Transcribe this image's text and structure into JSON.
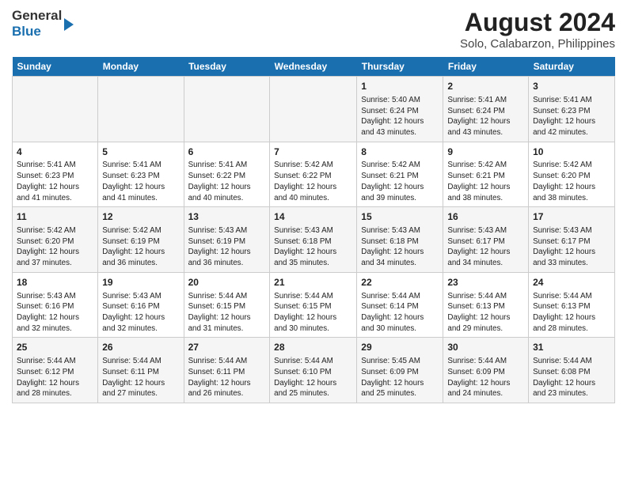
{
  "header": {
    "logo": {
      "line1": "General",
      "line2": "Blue"
    },
    "title": "August 2024",
    "subtitle": "Solo, Calabarzon, Philippines"
  },
  "days_of_week": [
    "Sunday",
    "Monday",
    "Tuesday",
    "Wednesday",
    "Thursday",
    "Friday",
    "Saturday"
  ],
  "weeks": [
    [
      {
        "day": "",
        "info": ""
      },
      {
        "day": "",
        "info": ""
      },
      {
        "day": "",
        "info": ""
      },
      {
        "day": "",
        "info": ""
      },
      {
        "day": "1",
        "info": "Sunrise: 5:40 AM\nSunset: 6:24 PM\nDaylight: 12 hours\nand 43 minutes."
      },
      {
        "day": "2",
        "info": "Sunrise: 5:41 AM\nSunset: 6:24 PM\nDaylight: 12 hours\nand 43 minutes."
      },
      {
        "day": "3",
        "info": "Sunrise: 5:41 AM\nSunset: 6:23 PM\nDaylight: 12 hours\nand 42 minutes."
      }
    ],
    [
      {
        "day": "4",
        "info": "Sunrise: 5:41 AM\nSunset: 6:23 PM\nDaylight: 12 hours\nand 41 minutes."
      },
      {
        "day": "5",
        "info": "Sunrise: 5:41 AM\nSunset: 6:23 PM\nDaylight: 12 hours\nand 41 minutes."
      },
      {
        "day": "6",
        "info": "Sunrise: 5:41 AM\nSunset: 6:22 PM\nDaylight: 12 hours\nand 40 minutes."
      },
      {
        "day": "7",
        "info": "Sunrise: 5:42 AM\nSunset: 6:22 PM\nDaylight: 12 hours\nand 40 minutes."
      },
      {
        "day": "8",
        "info": "Sunrise: 5:42 AM\nSunset: 6:21 PM\nDaylight: 12 hours\nand 39 minutes."
      },
      {
        "day": "9",
        "info": "Sunrise: 5:42 AM\nSunset: 6:21 PM\nDaylight: 12 hours\nand 38 minutes."
      },
      {
        "day": "10",
        "info": "Sunrise: 5:42 AM\nSunset: 6:20 PM\nDaylight: 12 hours\nand 38 minutes."
      }
    ],
    [
      {
        "day": "11",
        "info": "Sunrise: 5:42 AM\nSunset: 6:20 PM\nDaylight: 12 hours\nand 37 minutes."
      },
      {
        "day": "12",
        "info": "Sunrise: 5:42 AM\nSunset: 6:19 PM\nDaylight: 12 hours\nand 36 minutes."
      },
      {
        "day": "13",
        "info": "Sunrise: 5:43 AM\nSunset: 6:19 PM\nDaylight: 12 hours\nand 36 minutes."
      },
      {
        "day": "14",
        "info": "Sunrise: 5:43 AM\nSunset: 6:18 PM\nDaylight: 12 hours\nand 35 minutes."
      },
      {
        "day": "15",
        "info": "Sunrise: 5:43 AM\nSunset: 6:18 PM\nDaylight: 12 hours\nand 34 minutes."
      },
      {
        "day": "16",
        "info": "Sunrise: 5:43 AM\nSunset: 6:17 PM\nDaylight: 12 hours\nand 34 minutes."
      },
      {
        "day": "17",
        "info": "Sunrise: 5:43 AM\nSunset: 6:17 PM\nDaylight: 12 hours\nand 33 minutes."
      }
    ],
    [
      {
        "day": "18",
        "info": "Sunrise: 5:43 AM\nSunset: 6:16 PM\nDaylight: 12 hours\nand 32 minutes."
      },
      {
        "day": "19",
        "info": "Sunrise: 5:43 AM\nSunset: 6:16 PM\nDaylight: 12 hours\nand 32 minutes."
      },
      {
        "day": "20",
        "info": "Sunrise: 5:44 AM\nSunset: 6:15 PM\nDaylight: 12 hours\nand 31 minutes."
      },
      {
        "day": "21",
        "info": "Sunrise: 5:44 AM\nSunset: 6:15 PM\nDaylight: 12 hours\nand 30 minutes."
      },
      {
        "day": "22",
        "info": "Sunrise: 5:44 AM\nSunset: 6:14 PM\nDaylight: 12 hours\nand 30 minutes."
      },
      {
        "day": "23",
        "info": "Sunrise: 5:44 AM\nSunset: 6:13 PM\nDaylight: 12 hours\nand 29 minutes."
      },
      {
        "day": "24",
        "info": "Sunrise: 5:44 AM\nSunset: 6:13 PM\nDaylight: 12 hours\nand 28 minutes."
      }
    ],
    [
      {
        "day": "25",
        "info": "Sunrise: 5:44 AM\nSunset: 6:12 PM\nDaylight: 12 hours\nand 28 minutes."
      },
      {
        "day": "26",
        "info": "Sunrise: 5:44 AM\nSunset: 6:11 PM\nDaylight: 12 hours\nand 27 minutes."
      },
      {
        "day": "27",
        "info": "Sunrise: 5:44 AM\nSunset: 6:11 PM\nDaylight: 12 hours\nand 26 minutes."
      },
      {
        "day": "28",
        "info": "Sunrise: 5:44 AM\nSunset: 6:10 PM\nDaylight: 12 hours\nand 25 minutes."
      },
      {
        "day": "29",
        "info": "Sunrise: 5:45 AM\nSunset: 6:09 PM\nDaylight: 12 hours\nand 25 minutes."
      },
      {
        "day": "30",
        "info": "Sunrise: 5:44 AM\nSunset: 6:09 PM\nDaylight: 12 hours\nand 24 minutes."
      },
      {
        "day": "31",
        "info": "Sunrise: 5:44 AM\nSunset: 6:08 PM\nDaylight: 12 hours\nand 23 minutes."
      }
    ]
  ]
}
